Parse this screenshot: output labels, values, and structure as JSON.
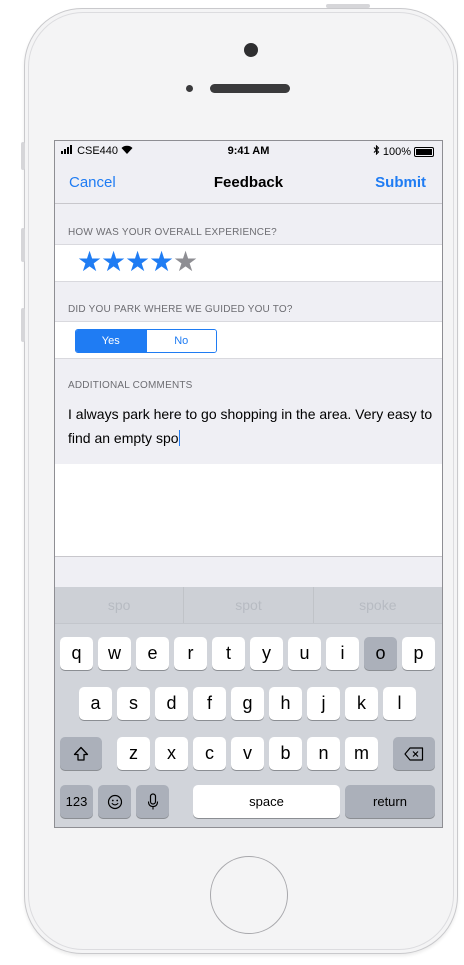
{
  "status_bar": {
    "carrier": "CSE440",
    "time": "9:41 AM",
    "battery": "100%"
  },
  "nav": {
    "cancel_label": "Cancel",
    "title": "Feedback",
    "submit_label": "Submit"
  },
  "experience": {
    "header": "HOW WAS YOUR OVERALL EXPERIENCE?",
    "rating": 4,
    "max_rating": 5,
    "star_color": "#1f7cf3",
    "empty_star_color": "#8e8e93"
  },
  "parking": {
    "header": "DID YOU PARK WHERE WE GUIDED YOU TO?",
    "options": [
      "Yes",
      "No"
    ],
    "selected": "Yes"
  },
  "comments": {
    "header": "ADDITIONAL COMMENTS",
    "value": "I always park here to go shopping in the area. Very easy to find an empty spo"
  },
  "keyboard": {
    "predictions": [
      "spo",
      "spot",
      "spoke"
    ],
    "row1": [
      "q",
      "w",
      "e",
      "r",
      "t",
      "y",
      "u",
      "i",
      "o",
      "p"
    ],
    "row2": [
      "a",
      "s",
      "d",
      "f",
      "g",
      "h",
      "j",
      "k",
      "l"
    ],
    "row3": [
      "z",
      "x",
      "c",
      "v",
      "b",
      "n",
      "m"
    ],
    "numbers_label": "123",
    "space_label": "space",
    "return_label": "return",
    "icons": {
      "shift": "shift-icon",
      "delete": "backspace-icon",
      "emoji": "emoji-icon",
      "dictation": "microphone-icon"
    }
  },
  "colors": {
    "accent": "#1f7cf3"
  }
}
